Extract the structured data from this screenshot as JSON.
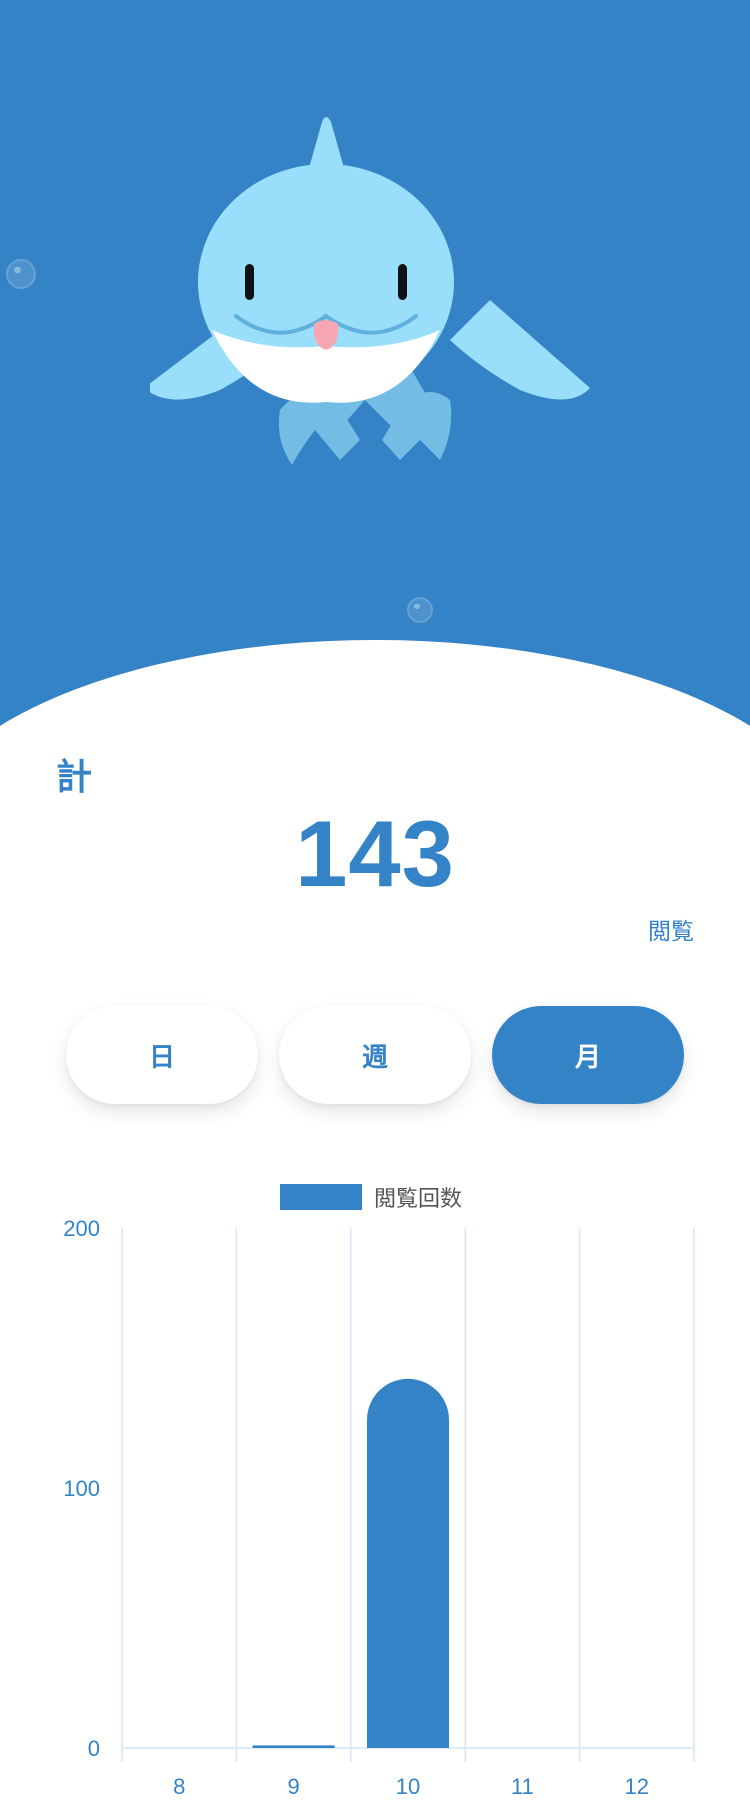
{
  "summary": {
    "total_label": "計",
    "total_value": "143",
    "unit_label": "閲覧"
  },
  "period_tabs": [
    {
      "label": "日",
      "active": false
    },
    {
      "label": "週",
      "active": false
    },
    {
      "label": "月",
      "active": true
    }
  ],
  "colors": {
    "primary": "#3583c7",
    "hero_bg": "#3583c7",
    "dolphin_body": "#99dffc",
    "grid": "#d4e6f7"
  },
  "icons": [
    "dolphin-illustration",
    "bubble"
  ],
  "chart_data": {
    "type": "bar",
    "legend": [
      "閲覧回数"
    ],
    "categories": [
      "8",
      "9",
      "10",
      "11",
      "12"
    ],
    "series": [
      {
        "name": "閲覧回数",
        "values": [
          0,
          1,
          142,
          0,
          0
        ]
      }
    ],
    "yticks": [
      0,
      100,
      200
    ],
    "ylim": [
      0,
      200
    ]
  }
}
